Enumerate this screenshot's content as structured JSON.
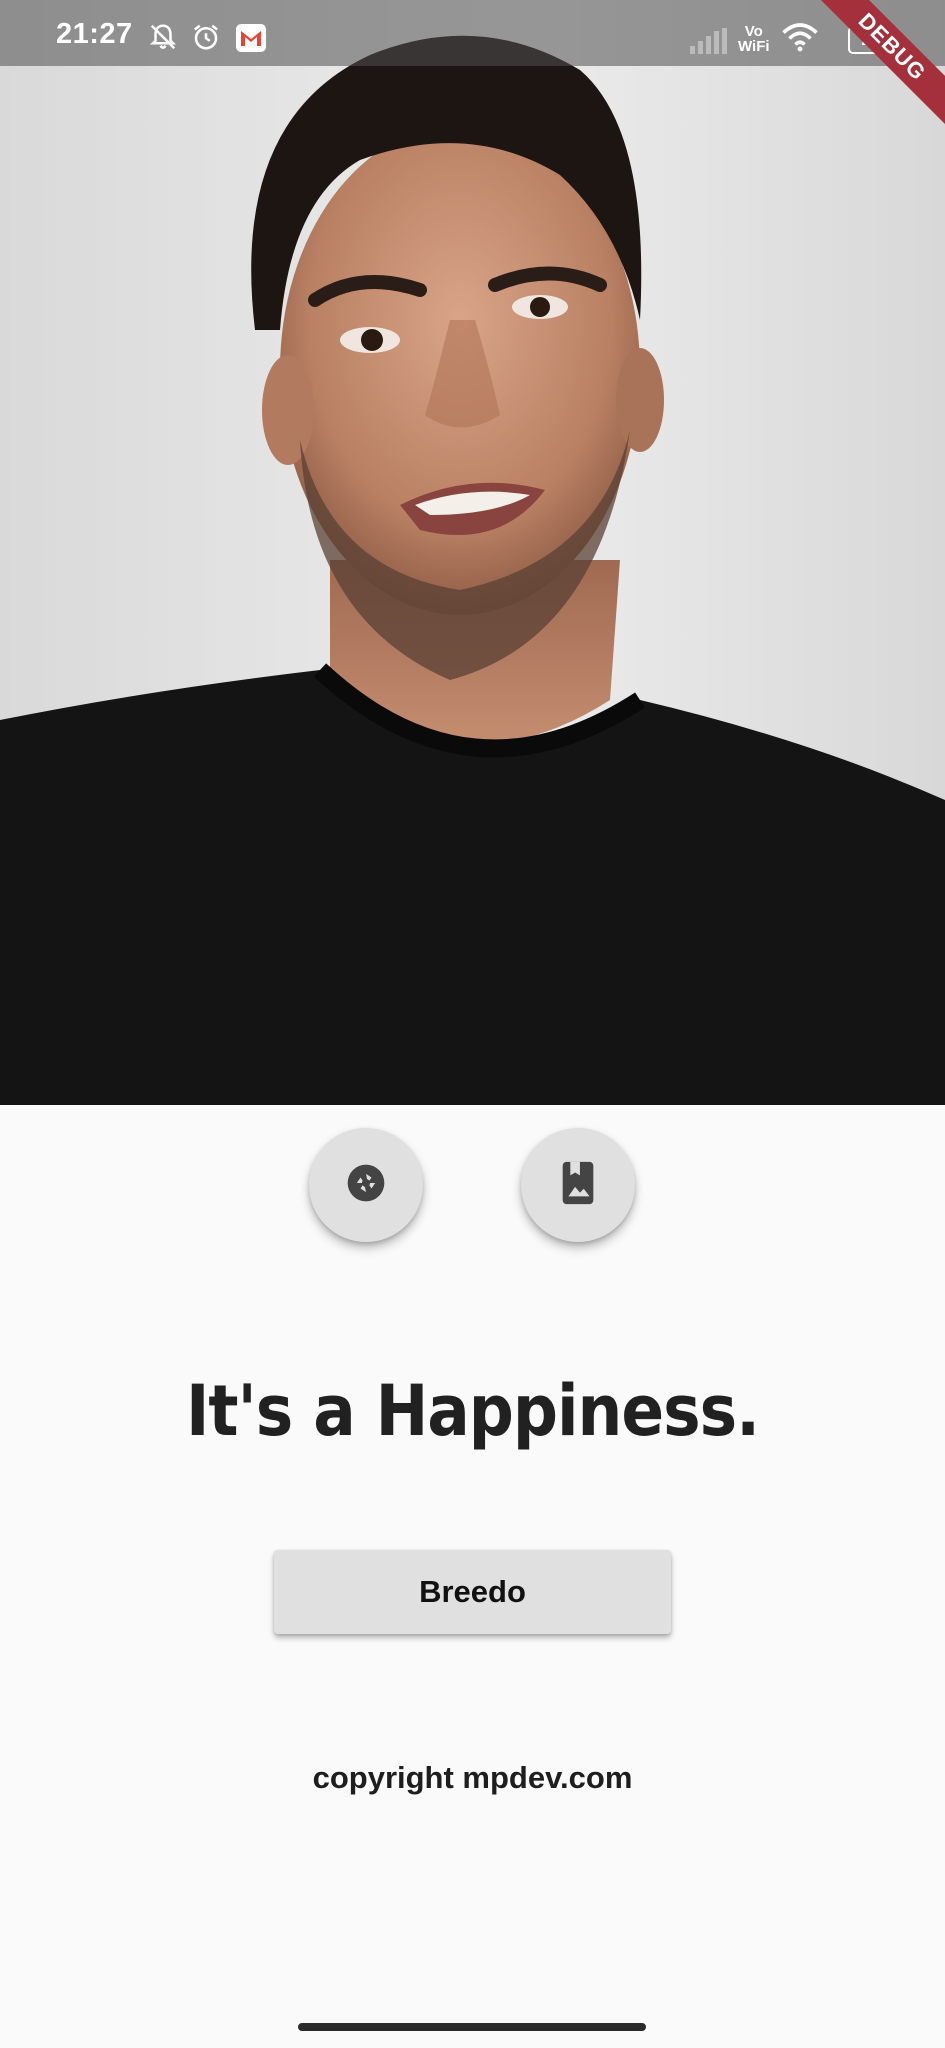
{
  "status_bar": {
    "time": "21:27",
    "icons": [
      "bell-off-icon",
      "alarm-icon",
      "gmail-icon",
      "signal-icon",
      "vowifi-icon",
      "wifi-icon",
      "battery-icon"
    ],
    "vowifi_top": "Vo",
    "vowifi_bottom": "WiFi",
    "battery_level": "28",
    "debug_banner": "DEBUG"
  },
  "photo": {
    "description_icon": "selfie-photo"
  },
  "actions": {
    "camera_icon": "camera-shutter-icon",
    "gallery_icon": "photo-album-icon"
  },
  "headline": "It's a Happiness.",
  "primary_button": "Breedo",
  "footer": {
    "copyright": "copyright mpdev.com"
  },
  "colors": {
    "background": "#fafafa",
    "button": "#e0e0e0",
    "text": "#212121",
    "debug_ribbon": "#a3303a"
  }
}
